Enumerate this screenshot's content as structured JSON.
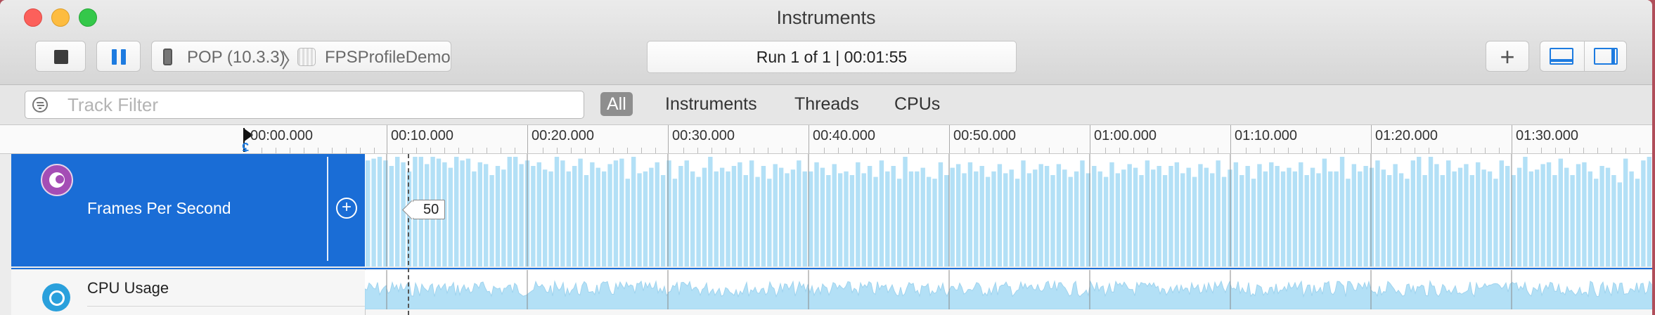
{
  "window": {
    "title": "Instruments"
  },
  "toolbar": {
    "device": "POP (10.3.3)",
    "app": "FPSProfileDemo",
    "run_status": "Run 1 of 1  |  00:01:55",
    "plus": "+"
  },
  "filter": {
    "placeholder": "Track Filter",
    "tabs": [
      {
        "label": "All",
        "active": true
      },
      {
        "label": "Instruments",
        "active": false
      },
      {
        "label": "Threads",
        "active": false
      },
      {
        "label": "CPUs",
        "active": false
      }
    ]
  },
  "ruler": {
    "labels": [
      "00:00.000",
      "00:10.000",
      "00:20.000",
      "00:30.000",
      "00:40.000",
      "00:50.000",
      "01:00.000",
      "01:10.000",
      "01:20.000",
      "01:30.000"
    ]
  },
  "tracks": {
    "fps": {
      "label": "Frames Per Second",
      "cursor_value": "50",
      "values": [
        58,
        59,
        60,
        58,
        55,
        60,
        57,
        52,
        60,
        60,
        56,
        60,
        59,
        57,
        54,
        60,
        58,
        59,
        52,
        57,
        56,
        50,
        55,
        53,
        60,
        60,
        56,
        58,
        55,
        57,
        53,
        52,
        60,
        58,
        52,
        55,
        59,
        50,
        57,
        54,
        52,
        56,
        58,
        59,
        48,
        60,
        51,
        52,
        54,
        57,
        50,
        58,
        48,
        55,
        58,
        52,
        49,
        54,
        60,
        52,
        54,
        52,
        55,
        57,
        50,
        58,
        49,
        55,
        48,
        56,
        54,
        51,
        53,
        58,
        52,
        52,
        57,
        54,
        50,
        56,
        51,
        52,
        50,
        57,
        51,
        55,
        49,
        58,
        52,
        55,
        48,
        60,
        52,
        52,
        54,
        49,
        48,
        57,
        50,
        54,
        56,
        51,
        57,
        52,
        55,
        49,
        52,
        56,
        51,
        53,
        48,
        58,
        51,
        53,
        56,
        55,
        50,
        56,
        53,
        49,
        52,
        58,
        51,
        55,
        52,
        49,
        57,
        51,
        53,
        56,
        54,
        50,
        58,
        53,
        55,
        50,
        55,
        57,
        51,
        54,
        49,
        56,
        54,
        51,
        58,
        49,
        53,
        57,
        50,
        55,
        48,
        56,
        52,
        57,
        55,
        52,
        54,
        52,
        57,
        50,
        54,
        51,
        59,
        52,
        52,
        60,
        48,
        56,
        52,
        55,
        54,
        58,
        53,
        50,
        56,
        51,
        48,
        58,
        60,
        50,
        60,
        56,
        50,
        58,
        52,
        54,
        56,
        50,
        57,
        53,
        52,
        48,
        58,
        55,
        50,
        54,
        60,
        52,
        53,
        56,
        57,
        50,
        59,
        54,
        50,
        56,
        57,
        52,
        48,
        55,
        54,
        50,
        46,
        59,
        52,
        48,
        58,
        60
      ],
      "max": 60
    },
    "cpu": {
      "label": "CPU Usage"
    }
  }
}
